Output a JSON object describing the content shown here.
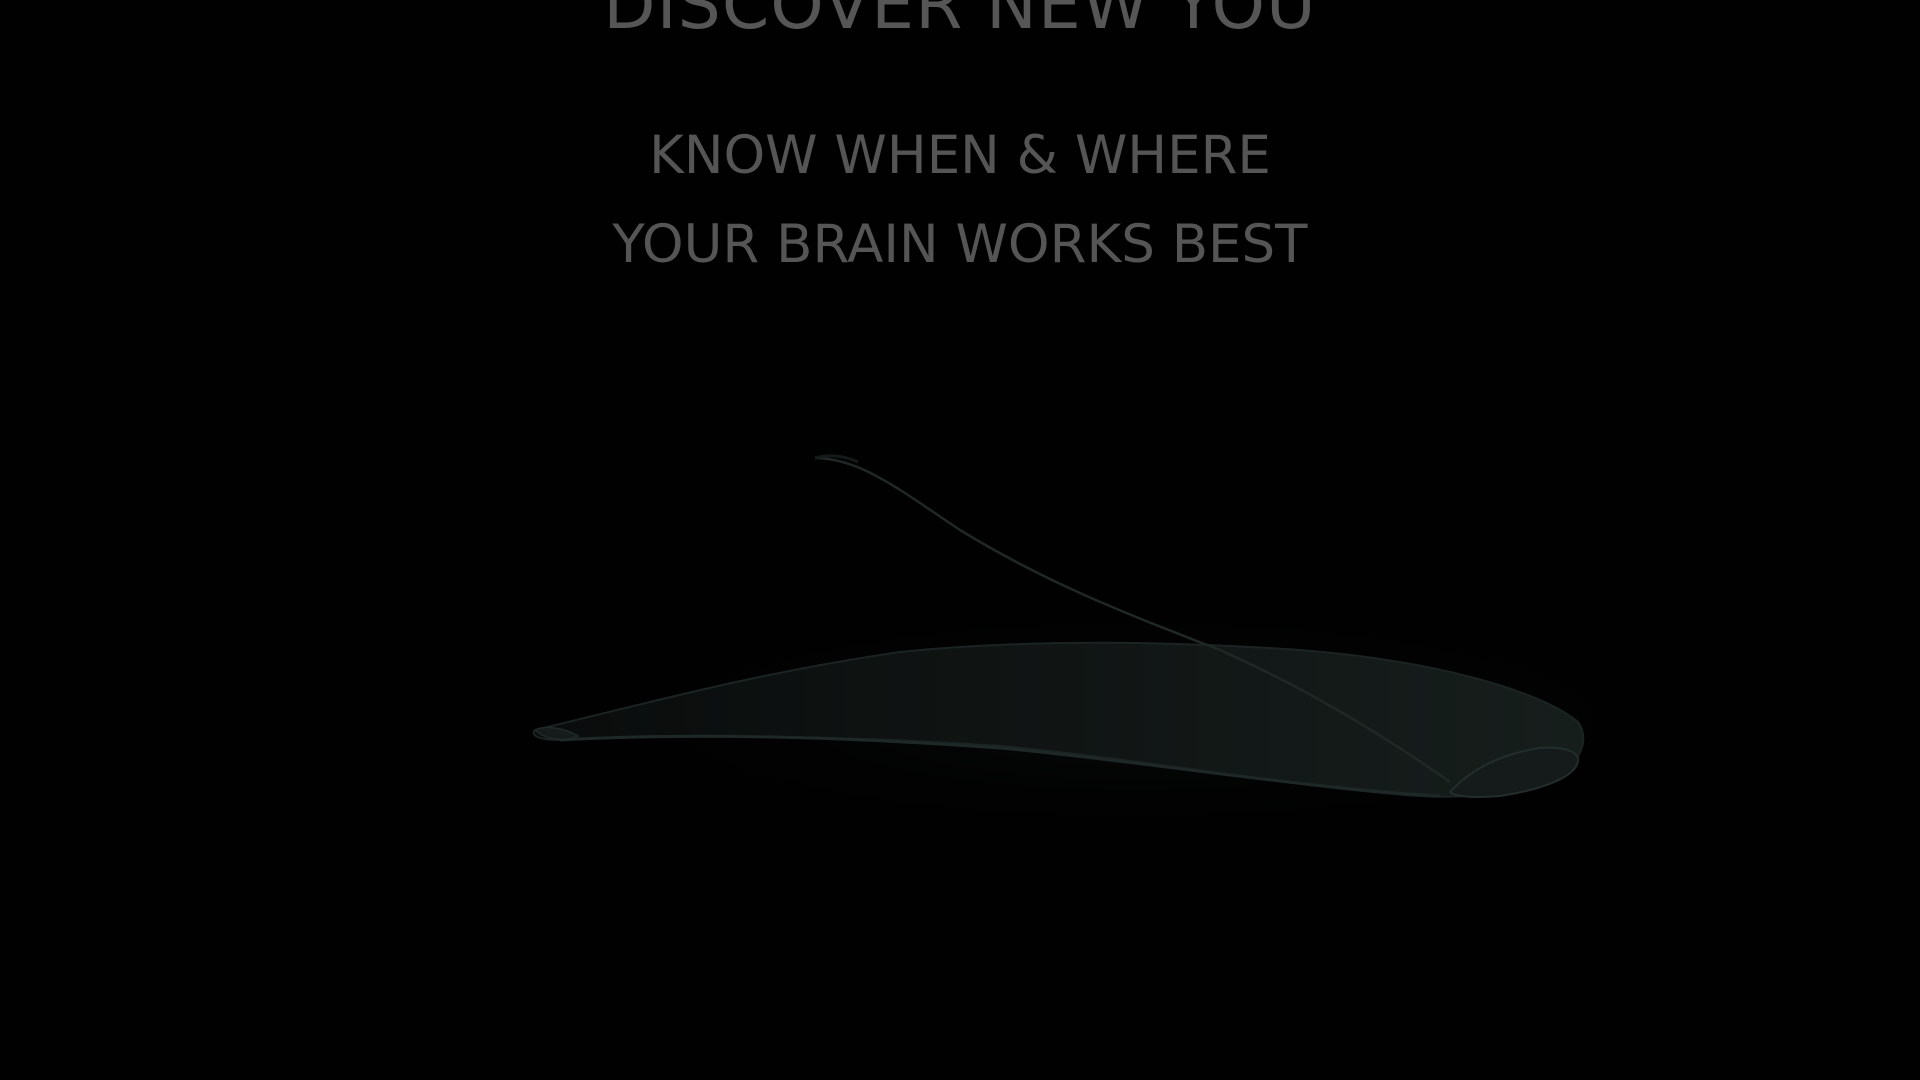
{
  "hero": {
    "headline": "DISCOVER NEW YOU",
    "tagline_line1": "KNOW WHEN & WHERE",
    "tagline_line2": "YOUR BRAIN WORKS BEST"
  },
  "product_image": {
    "icon": "headset-icon"
  },
  "colors": {
    "background": "#010101",
    "text": "#555555",
    "headset_edge": "#1c2624"
  }
}
